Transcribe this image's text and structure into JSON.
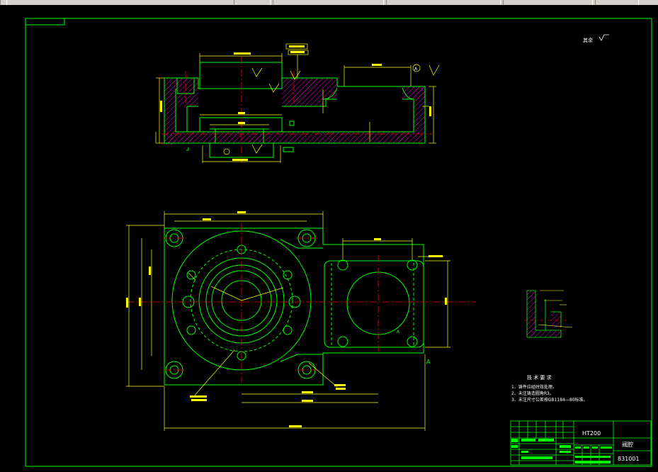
{
  "window": {
    "toolbar_fragments": [
      "",
      "",
      "",
      "",
      ""
    ]
  },
  "drawing": {
    "surface_note": "其余",
    "technical_requirements": {
      "heading": "技 术 要 求",
      "items": [
        "1、铸件应经时效处理。",
        "2、未注铸造圆角R3。",
        "3、未注尺寸公差按GB1184—80标准。"
      ]
    },
    "title_block": {
      "material": "HT200",
      "part_name": "阀腔",
      "drawing_number": "831001"
    },
    "section_marker": "A",
    "view_marker": "A"
  },
  "colors": {
    "background": "#000000",
    "outline": "#00ff00",
    "dimension": "#ffff00",
    "centerline": "#ff0000",
    "hatch": "#ff00ff",
    "frame": "#00ff00",
    "text": "#ffffff"
  }
}
